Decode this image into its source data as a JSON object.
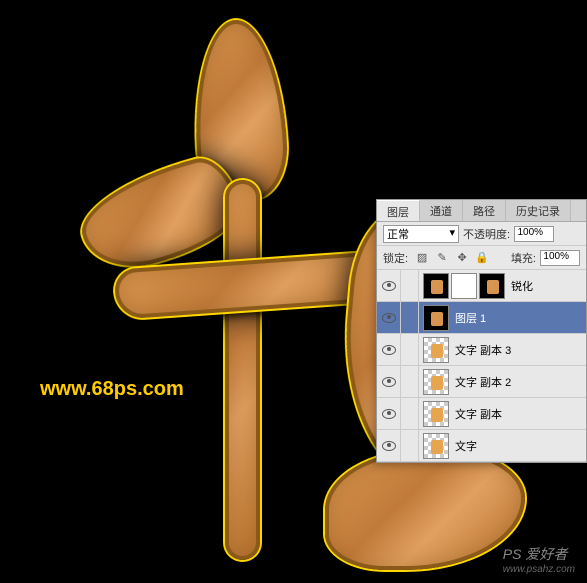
{
  "watermarks": {
    "url1": "www.68ps.com",
    "brand": "PS 爱好者",
    "url2": "www.psahz.com"
  },
  "panel": {
    "tabs": {
      "layers": "图层",
      "channels": "通道",
      "paths": "路径",
      "history": "历史记录"
    },
    "blend_mode": "正常",
    "opacity_label": "不透明度:",
    "opacity_value": "100%",
    "lock_label": "锁定:",
    "fill_label": "填充:",
    "fill_value": "100%",
    "layers": [
      {
        "name": "锐化",
        "visible": true,
        "selected": false,
        "thumbs": 3
      },
      {
        "name": "图层 1",
        "visible": true,
        "selected": true,
        "thumbs": 1
      },
      {
        "name": "文字 副本 3",
        "visible": true,
        "selected": false,
        "thumbs": 1
      },
      {
        "name": "文字 副本 2",
        "visible": true,
        "selected": false,
        "thumbs": 1
      },
      {
        "name": "文字 副本",
        "visible": true,
        "selected": false,
        "thumbs": 1
      },
      {
        "name": "文字",
        "visible": true,
        "selected": false,
        "thumbs": 1
      }
    ]
  }
}
